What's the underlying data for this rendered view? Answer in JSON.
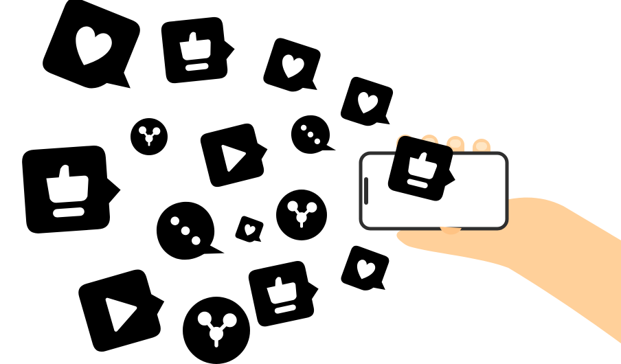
{
  "illustration": {
    "subject": "hand-holding-smartphone-with-social-media-reaction-icons",
    "colors": {
      "heart_red": "#FF4D5E",
      "like_blue": "#4C8DF6",
      "play_pink": "#F23FA6",
      "share_yellow": "#FDBE35",
      "chat_purple": "#BE5DEA",
      "skin": "#FFD09A",
      "phone_frame": "#2F2F2F",
      "phone_screen": "#FFFFFF",
      "glyph_white": "#FFFFFF"
    },
    "icons": [
      {
        "type": "heart-icon"
      },
      {
        "type": "like-icon"
      },
      {
        "type": "heart-icon"
      },
      {
        "type": "heart-icon"
      },
      {
        "type": "share-icon"
      },
      {
        "type": "play-icon"
      },
      {
        "type": "chat-icon"
      },
      {
        "type": "like-icon"
      },
      {
        "type": "chat-icon"
      },
      {
        "type": "heart-icon"
      },
      {
        "type": "share-icon"
      },
      {
        "type": "heart-icon"
      },
      {
        "type": "like-icon"
      },
      {
        "type": "play-icon"
      },
      {
        "type": "share-icon"
      },
      {
        "type": "like-icon"
      }
    ]
  }
}
